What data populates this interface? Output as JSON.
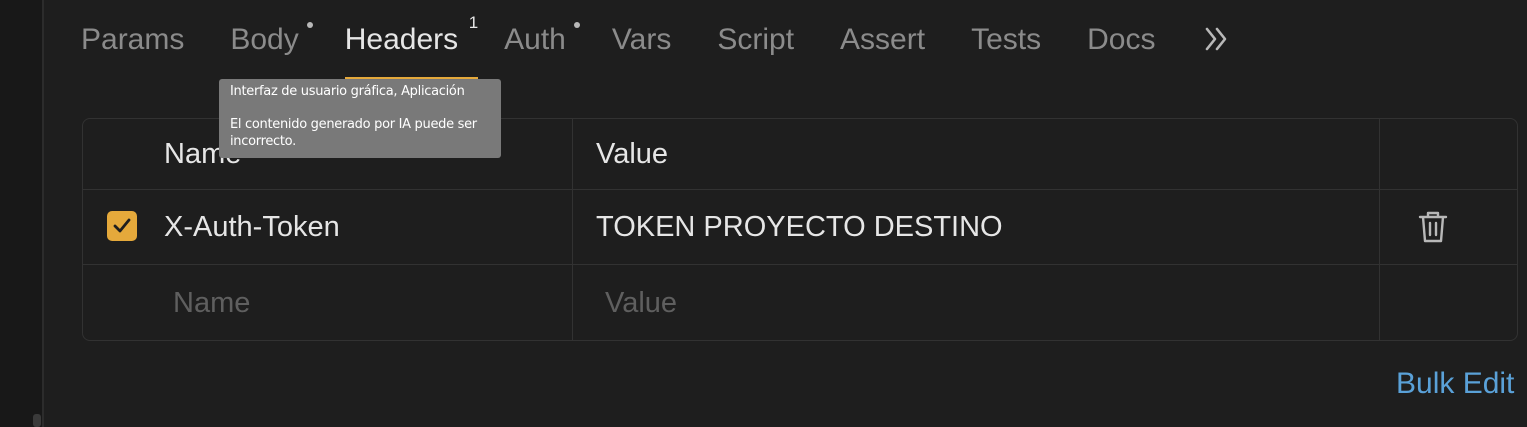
{
  "tabs": [
    {
      "label": "Params",
      "active": false,
      "indicator": ""
    },
    {
      "label": "Body",
      "active": false,
      "indicator": "dot"
    },
    {
      "label": "Headers",
      "active": true,
      "indicator": "1"
    },
    {
      "label": "Auth",
      "active": false,
      "indicator": "dot"
    },
    {
      "label": "Vars",
      "active": false,
      "indicator": ""
    },
    {
      "label": "Script",
      "active": false,
      "indicator": ""
    },
    {
      "label": "Assert",
      "active": false,
      "indicator": ""
    },
    {
      "label": "Tests",
      "active": false,
      "indicator": ""
    },
    {
      "label": "Docs",
      "active": false,
      "indicator": ""
    }
  ],
  "tabs_more_label": "»",
  "headers_table": {
    "columns": {
      "name": "Name",
      "value": "Value"
    },
    "rows": [
      {
        "enabled": true,
        "name": "X-Auth-Token",
        "value": "TOKEN PROYECTO DESTINO"
      }
    ],
    "new_row": {
      "name_placeholder": "Name",
      "value_placeholder": "Value"
    }
  },
  "bulk_edit_label": "Bulk Edit",
  "tooltip": {
    "line1": "Interfaz de usuario gráfica, Aplicación",
    "line2": "El contenido generado por IA puede ser incorrecto."
  },
  "colors": {
    "background": "#1e1e1e",
    "accent": "#e5a93b",
    "link": "#5aa1d8",
    "tooltip_bg": "#797979"
  },
  "icons": {
    "more": "double-chevron-right-icon",
    "checkbox": "check-icon",
    "delete": "trash-icon"
  }
}
